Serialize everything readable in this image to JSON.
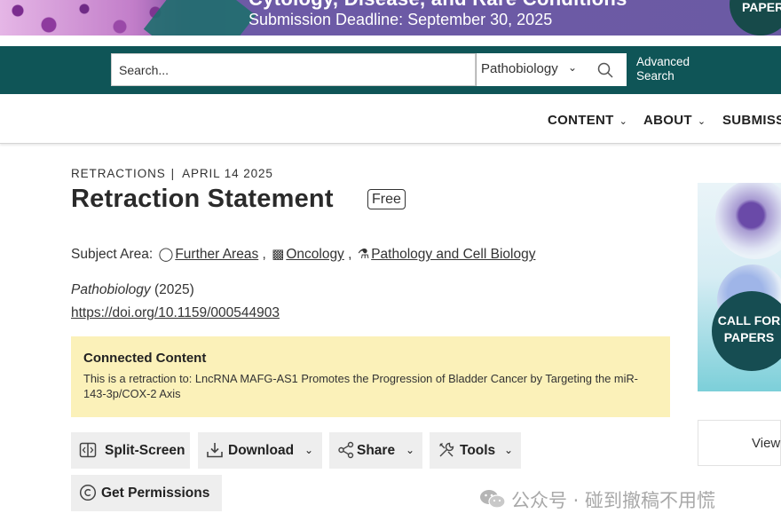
{
  "banner": {
    "title": "Cytology, Disease, and Rare Conditions",
    "deadline": "Submission Deadline: September 30, 2025",
    "badge": "PAPER"
  },
  "search": {
    "placeholder": "Search...",
    "scope": "Pathobiology",
    "advanced_label": "Advanced Search"
  },
  "nav": {
    "items": [
      {
        "label": "CONTENT"
      },
      {
        "label": "ABOUT"
      },
      {
        "label": "SUBMISS"
      }
    ]
  },
  "article": {
    "category": "RETRACTIONS",
    "date": "APRIL 14 2025",
    "title": "Retraction Statement",
    "access_badge": "Free",
    "subject_label": "Subject Area:",
    "subjects": [
      {
        "label": "Further Areas",
        "icon": "circle-icon"
      },
      {
        "label": "Oncology",
        "icon": "cells-icon"
      },
      {
        "label": "Pathology and Cell Biology",
        "icon": "microscope-icon"
      }
    ],
    "journal": "Pathobiology",
    "year": "(2025)",
    "doi": "https://doi.org/10.1159/000544903"
  },
  "connected": {
    "heading": "Connected Content",
    "text": "This is a retraction to: LncRNA MAFG-AS1 Promotes the Progression of Bladder Cancer by Targeting the miR-143-3p/COX-2 Axis"
  },
  "toolbar": {
    "split_screen": "Split-Screen",
    "download": "Download",
    "share": "Share",
    "tools": "Tools",
    "permissions": "Get Permissions"
  },
  "sidebar": {
    "ad_text": "CALL FOR PAPERS",
    "view_label": "View"
  },
  "watermark": {
    "text": "公众号 · 碰到撤稿不用慌"
  },
  "colors": {
    "header_teal": "#0f5557",
    "connected_bg": "#fbf1b9",
    "tool_bg": "#eeeeee"
  }
}
